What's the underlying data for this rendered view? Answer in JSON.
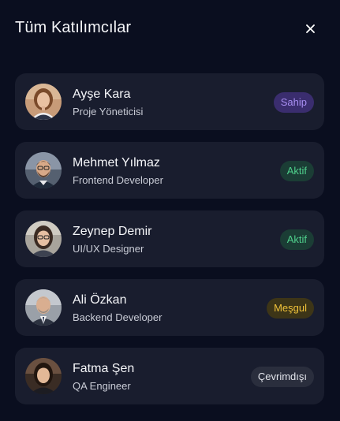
{
  "header": {
    "title": "Tüm Katılımcılar",
    "close_icon": "close-icon"
  },
  "participants": [
    {
      "name": "Ayşe Kara",
      "role": "Proje Yöneticisi",
      "status": "Sahip",
      "status_color": "#a88ef2"
    },
    {
      "name": "Mehmet Yılmaz",
      "role": "Frontend Developer",
      "status": "Aktif",
      "status_color": "#4fd08c"
    },
    {
      "name": "Zeynep Demir",
      "role": "UI/UX Designer",
      "status": "Aktif",
      "status_color": "#4fd08c"
    },
    {
      "name": "Ali Özkan",
      "role": "Backend Developer",
      "status": "Meşgul",
      "status_color": "#f0c23a"
    },
    {
      "name": "Fatma Şen",
      "role": "QA Engineer",
      "status": "Çevrimdışı",
      "status_color": "#e3e5ec"
    }
  ],
  "colors": {
    "background": "#0a0e1f",
    "card": "#191d2e"
  }
}
